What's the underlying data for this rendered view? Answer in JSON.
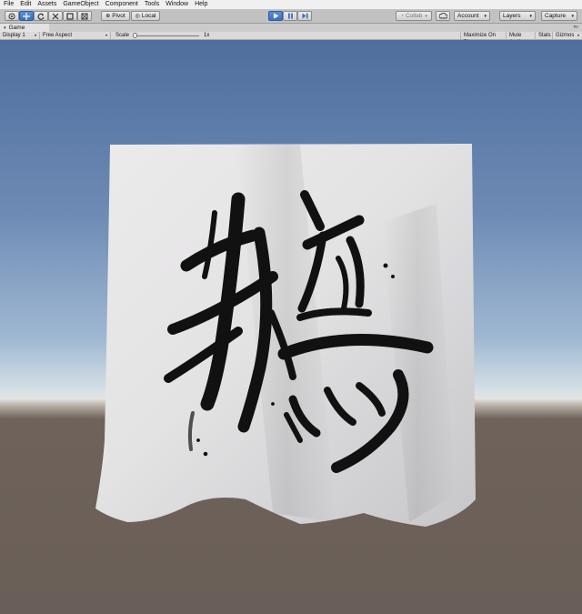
{
  "menu": [
    "File",
    "Edit",
    "Assets",
    "GameObject",
    "Component",
    "Tools",
    "Window",
    "Help"
  ],
  "toolbar": {
    "pivot_label": "Pivot",
    "local_label": "Local",
    "collab_label": "Collab",
    "account_label": "Account",
    "layers_label": "Layers",
    "capture_label": "Capture",
    "play_state": "playing"
  },
  "tab": {
    "label": "Game"
  },
  "game_toolbar": {
    "display": "Display 1",
    "aspect": "Free Aspect",
    "scale_label": "Scale",
    "scale_value": "1x",
    "maximize_on_play": "Maximize On Play",
    "mute_audio": "Mute Audio",
    "stats": "Stats",
    "gizmos": "Gizmos"
  },
  "colors": {
    "play_active": "#3a6fc0",
    "sky_top": "#4f6e9d",
    "horizon": "#e2e5e4",
    "ground": "#6a5f58",
    "cloth": "#e7e6e7",
    "ink": "#111111"
  },
  "icons": [
    "hand-tool-icon",
    "move-tool-icon",
    "rotate-tool-icon",
    "scale-tool-icon",
    "rect-tool-icon",
    "transform-tool-icon",
    "play-icon",
    "pause-icon",
    "step-icon",
    "cloud-icon"
  ]
}
